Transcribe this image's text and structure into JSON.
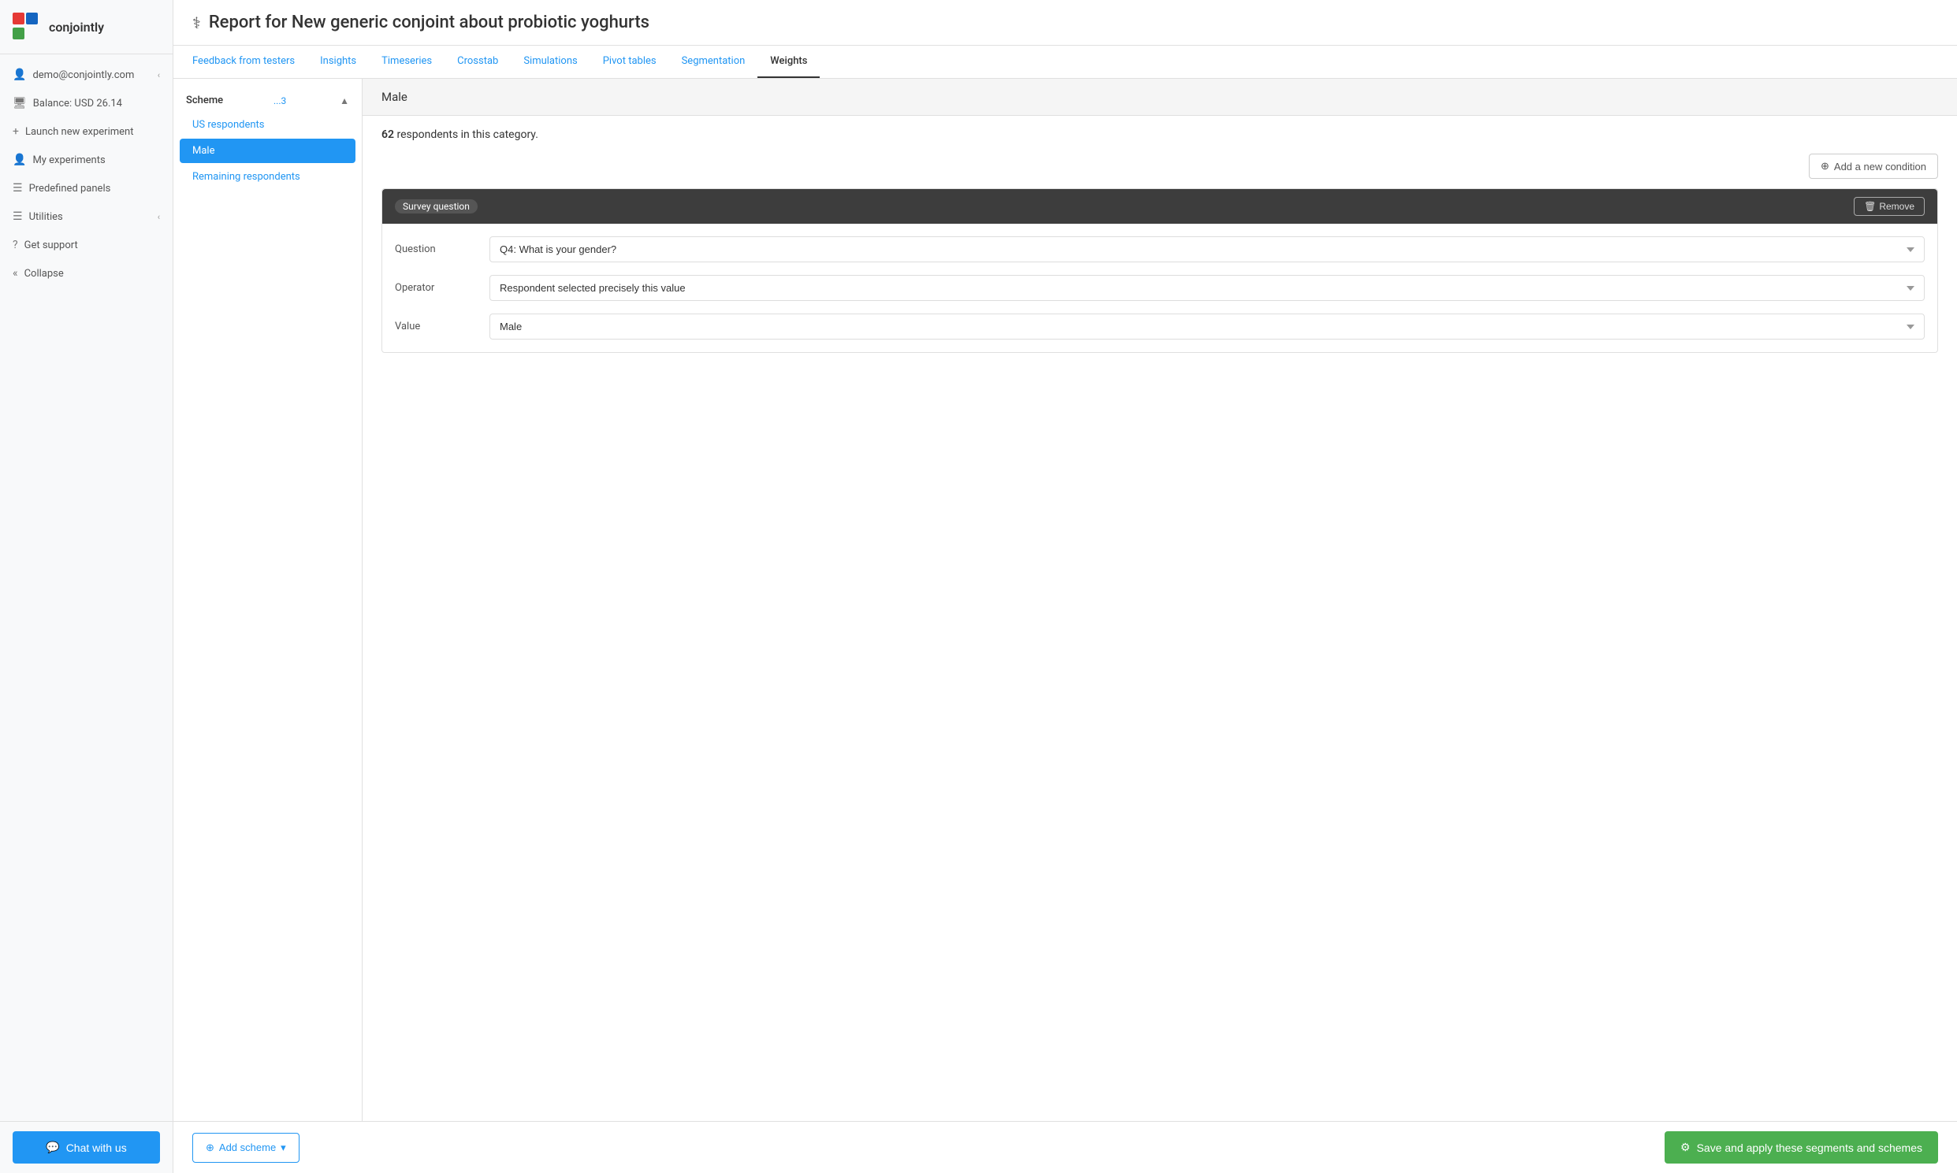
{
  "sidebar": {
    "logo_text": "conjointly",
    "user_email": "demo@conjointly.com",
    "balance": "Balance: USD 26.14",
    "nav_items": [
      {
        "id": "launch",
        "label": "Launch new experiment",
        "icon": "+"
      },
      {
        "id": "my-experiments",
        "label": "My experiments",
        "icon": "👤"
      },
      {
        "id": "predefined-panels",
        "label": "Predefined panels",
        "icon": "☰"
      },
      {
        "id": "utilities",
        "label": "Utilities",
        "icon": "☰"
      },
      {
        "id": "get-support",
        "label": "Get support",
        "icon": "?"
      },
      {
        "id": "collapse",
        "label": "Collapse",
        "icon": "«"
      }
    ],
    "chat_btn_label": "Chat with us"
  },
  "header": {
    "icon": "⚕",
    "title": "Report for New generic conjoint about probiotic yoghurts"
  },
  "tabs": [
    {
      "id": "feedback",
      "label": "Feedback from testers",
      "active": false
    },
    {
      "id": "insights",
      "label": "Insights",
      "active": false
    },
    {
      "id": "timeseries",
      "label": "Timeseries",
      "active": false
    },
    {
      "id": "crosstab",
      "label": "Crosstab",
      "active": false
    },
    {
      "id": "simulations",
      "label": "Simulations",
      "active": false
    },
    {
      "id": "pivot-tables",
      "label": "Pivot tables",
      "active": false
    },
    {
      "id": "segmentation",
      "label": "Segmentation",
      "active": false
    },
    {
      "id": "weights",
      "label": "Weights",
      "active": true
    }
  ],
  "left_panel": {
    "scheme_label": "Scheme",
    "scheme_badge": "...3",
    "items": [
      {
        "id": "us-respondents",
        "label": "US respondents",
        "active": false
      },
      {
        "id": "male",
        "label": "Male",
        "active": true
      },
      {
        "id": "remaining",
        "label": "Remaining respondents",
        "active": false
      }
    ]
  },
  "right_panel": {
    "category_title": "Male",
    "respondent_count": "62",
    "respondent_suffix": " respondents in this category.",
    "add_condition_label": "Add a new condition",
    "condition": {
      "badge_label": "Survey question",
      "remove_label": "Remove",
      "question_label": "Question",
      "question_value": "Q4: What is your gender?",
      "operator_label": "Operator",
      "operator_value": "Respondent selected precisely this value",
      "value_label": "Value",
      "value_value": "Male"
    }
  },
  "bottom_bar": {
    "add_scheme_label": "Add scheme",
    "save_label": "Save and apply these segments and schemes"
  }
}
